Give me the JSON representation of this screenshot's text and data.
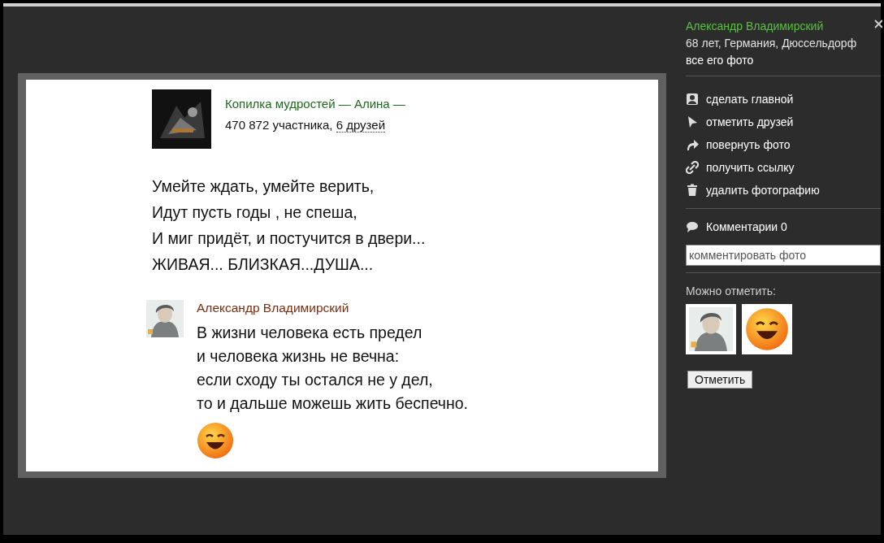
{
  "photo": {
    "group": {
      "title": "Копилка мудростей — Алина —",
      "members": "470 872 участника, ",
      "friends": "6 друзей"
    },
    "poem": [
      "Умейте ждать, умейте верить,",
      "Идут пусть годы , не спеша,",
      "И миг придёт, и постучится в двери...",
      "ЖИВАЯ... БЛИЗКАЯ...ДУША..."
    ],
    "comment": {
      "author": "Александр Владимирский",
      "lines": [
        "В жизни человека есть предел",
        "и человека жизнь не вечна:",
        "если сходу ты остался не у дел,",
        "то и дальше можешь жить беспечно."
      ]
    }
  },
  "sidebar": {
    "author": {
      "name": "Александр Владимирский",
      "details": "68 лет, Германия, Дюссельдорф",
      "all_photos": "все его фото"
    },
    "actions": [
      {
        "kind": "make-main",
        "label": "сделать главной"
      },
      {
        "kind": "tag",
        "label": "отметить друзей"
      },
      {
        "kind": "rotate",
        "label": "повернуть фото"
      },
      {
        "kind": "link",
        "label": "получить ссылку"
      },
      {
        "kind": "delete",
        "label": "удалить фотографию"
      }
    ],
    "comments": "Комментарии 0",
    "comment_field": {
      "placeholder": "комментировать фото"
    },
    "tag_title": "Можно отметить:",
    "candidates": [
      {
        "kind": "person"
      },
      {
        "kind": "emoji"
      }
    ],
    "tag_button": "Отметить"
  }
}
